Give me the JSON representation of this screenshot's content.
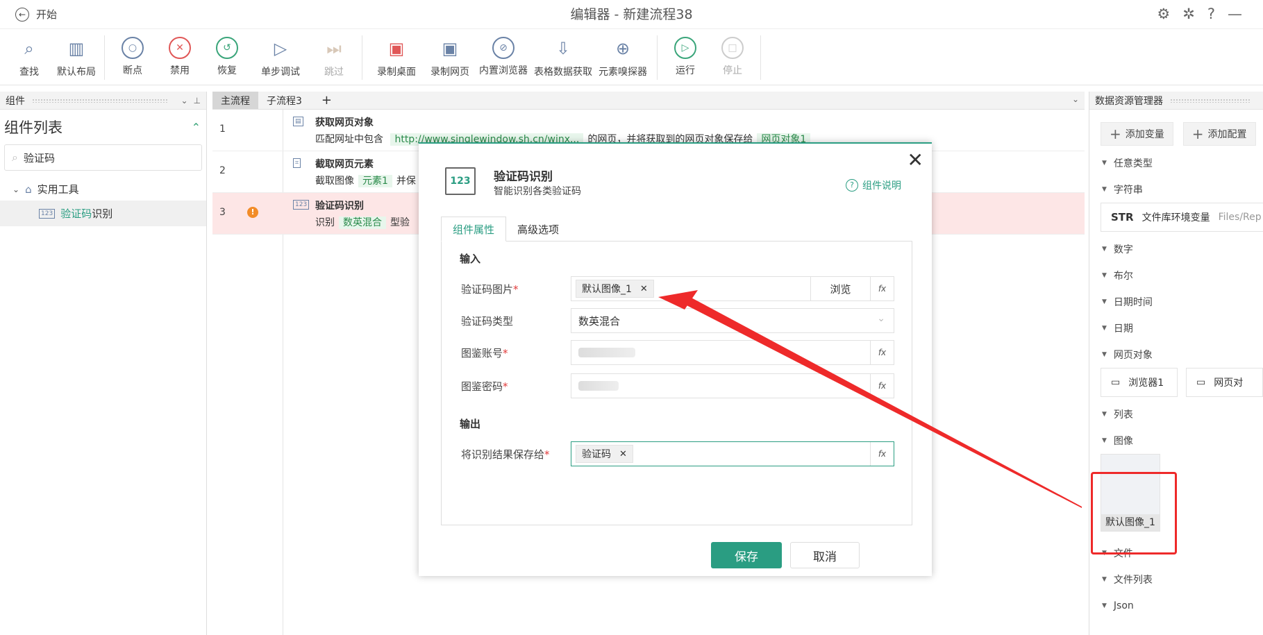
{
  "titlebar": {
    "back_label": "开始",
    "title": "编辑器 - 新建流程38"
  },
  "toolbar": {
    "items": [
      {
        "label": "查找",
        "icon": "magnifier-icon"
      },
      {
        "label": "默认布局",
        "icon": "layout-icon"
      },
      {
        "label": "断点",
        "icon": "breakpoint-icon"
      },
      {
        "label": "禁用",
        "icon": "disable-icon"
      },
      {
        "label": "恢复",
        "icon": "restore-icon"
      },
      {
        "label": "单步调试",
        "icon": "step-debug-icon"
      },
      {
        "label": "跳过",
        "icon": "skip-icon"
      },
      {
        "label": "录制桌面",
        "icon": "record-desktop-icon"
      },
      {
        "label": "录制网页",
        "icon": "record-web-icon"
      },
      {
        "label": "内置浏览器",
        "icon": "compass-icon"
      },
      {
        "label": "表格数据获取",
        "icon": "download-table-icon"
      },
      {
        "label": "元素嗅探器",
        "icon": "target-icon"
      },
      {
        "label": "运行",
        "icon": "play-icon"
      },
      {
        "label": "停止",
        "icon": "stop-icon"
      }
    ]
  },
  "left_panel": {
    "header": "组件",
    "list_title": "组件列表",
    "search_value": "验证码",
    "group": "实用工具",
    "item_highlight": "验证码",
    "item_rest": "识别"
  },
  "center": {
    "tabs": [
      "主流程",
      "子流程3",
      "+"
    ],
    "rows": [
      {
        "num": "1",
        "title": "获取网页对象",
        "desc_prefix": "匹配网址中包含",
        "link": "http://www.singlewindow.sh.cn/winx...",
        "desc_mid": "的网页，并将获取到的网页对象保存给",
        "tag": "网页对象1"
      },
      {
        "num": "2",
        "title": "截取网页元素",
        "desc_prefix": "截取图像",
        "tag": "元素1",
        "desc_mid": "并保"
      },
      {
        "num": "3",
        "title": "验证码识别",
        "desc_prefix": "识别",
        "tag": "数英混合",
        "desc_mid": "型验"
      }
    ]
  },
  "right_panel": {
    "header": "数据资源管理器",
    "add_variable": "添加变量",
    "add_config": "添加配置",
    "categories": {
      "any": "任意类型",
      "string": "字符串",
      "number": "数字",
      "bool": "布尔",
      "datetime": "日期时间",
      "date": "日期",
      "webobj": "网页对象",
      "list": "列表",
      "image": "图像",
      "file": "文件",
      "filelist": "文件列表",
      "json": "Json"
    },
    "string_card": {
      "badge": "STR",
      "name": "文件库环境变量",
      "path": "Files/Rep"
    },
    "web_cards": [
      "浏览器1",
      "网页对"
    ],
    "image_card": "默认图像_1"
  },
  "dialog": {
    "icon_text": "123",
    "title": "验证码识别",
    "subtitle": "智能识别各类验证码",
    "help": "组件说明",
    "tabs": [
      "组件属性",
      "高级选项"
    ],
    "input_section": "输入",
    "output_section": "输出",
    "fields": {
      "image_label": "验证码图片",
      "image_chip": "默认图像_1",
      "browse": "浏览",
      "type_label": "验证码类型",
      "type_value": "数英混合",
      "account_label": "图鉴账号",
      "password_label": "图鉴密码",
      "save_label": "将识别结果保存给",
      "save_chip": "验证码"
    },
    "required_mark": "*",
    "save_button": "保存",
    "cancel_button": "取消",
    "close": "✕",
    "fx": "fx"
  },
  "colors": {
    "accent": "#2a9d82",
    "annotation": "#ee2a2a",
    "error_row": "#fde6e6"
  }
}
